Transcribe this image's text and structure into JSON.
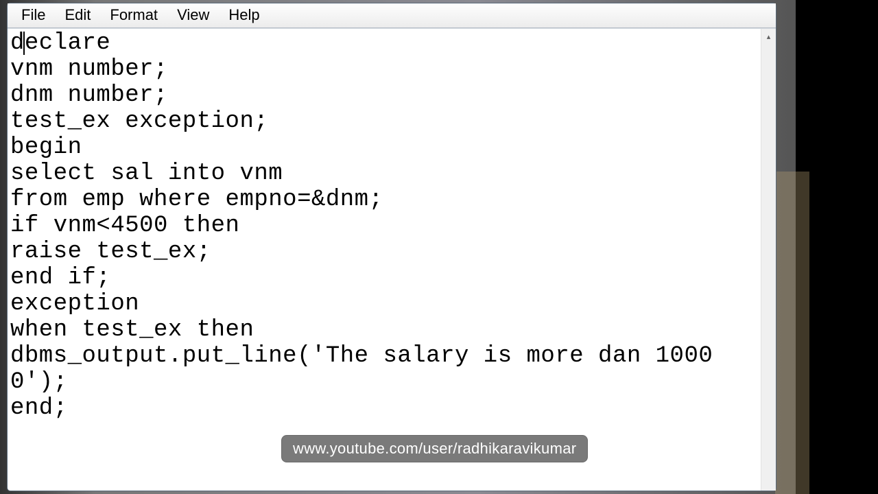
{
  "menubar": {
    "items": [
      "File",
      "Edit",
      "Format",
      "View",
      "Help"
    ]
  },
  "editor": {
    "content": "declare\nvnm number;\ndnm number;\ntest_ex exception;\nbegin\nselect sal into vnm\nfrom emp where empno=&dnm;\nif vnm<4500 then\nraise test_ex;\nend if;\nexception\nwhen test_ex then\ndbms_output.put_line('The salary is more dan 10000');\nend;"
  },
  "watermark": {
    "text": "www.youtube.com/user/radhikaravikumar"
  },
  "scroll": {
    "up_arrow": "▴"
  }
}
